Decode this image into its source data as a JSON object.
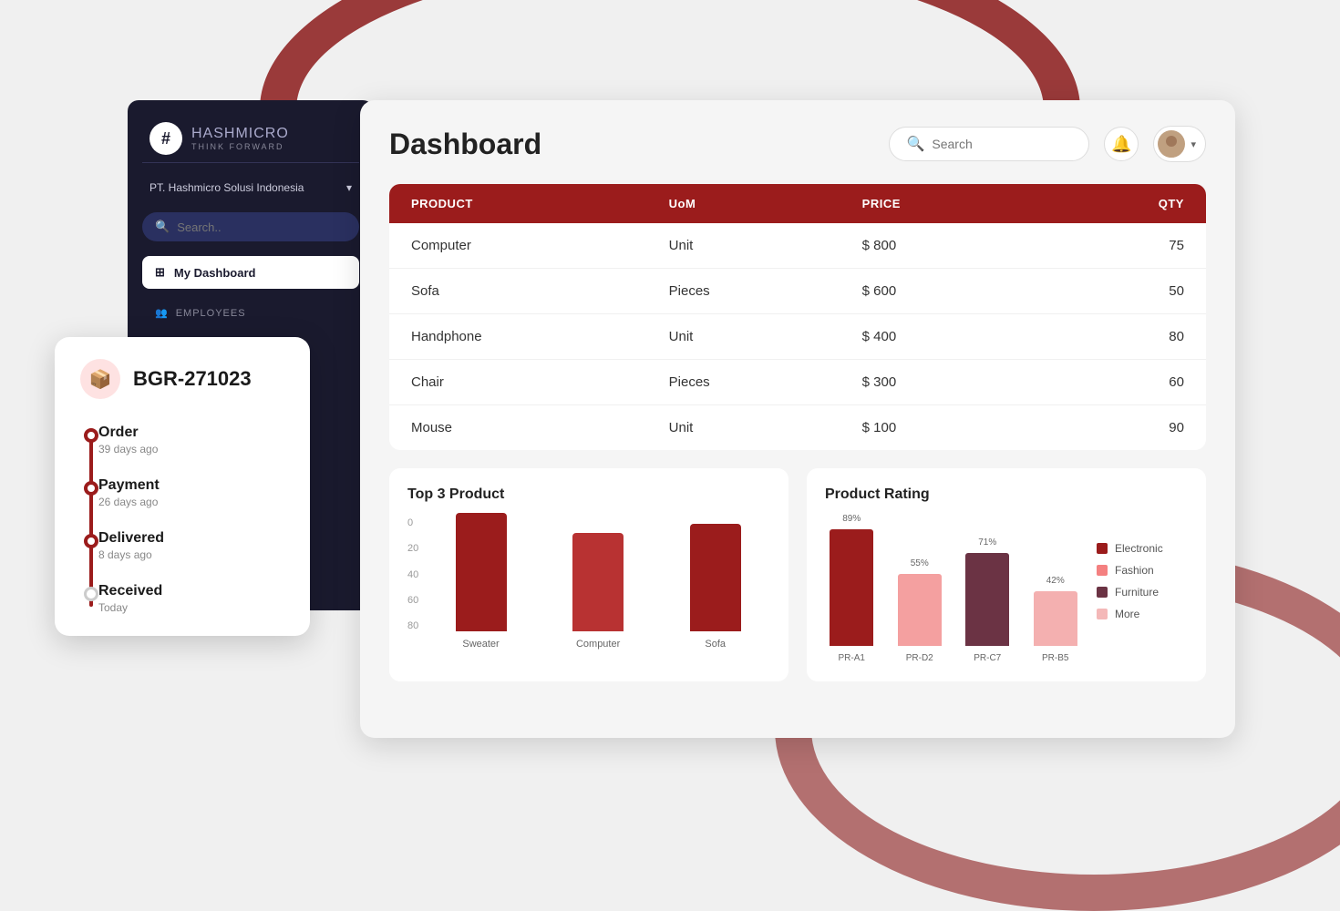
{
  "background": {
    "arc_color": "#8b1a1a"
  },
  "sidebar": {
    "logo": {
      "icon": "#",
      "name_bold": "HASH",
      "name_regular": "MICRO",
      "tagline": "THINK FORWARD"
    },
    "company": "PT. Hashmicro Solusi Indonesia",
    "search_placeholder": "Search..",
    "nav_items": [
      {
        "label": "My Dashboard",
        "active": true,
        "icon": "grid-icon"
      },
      {
        "label": "EMPLOYEES",
        "active": false,
        "icon": "users-icon"
      }
    ]
  },
  "header": {
    "title": "Dashboard",
    "search_placeholder": "Search",
    "notification_icon": "bell-icon",
    "avatar_icon": "avatar-icon"
  },
  "table": {
    "columns": [
      "PRODUCT",
      "UoM",
      "PRICE",
      "QTY"
    ],
    "rows": [
      {
        "product": "Computer",
        "uom": "Unit",
        "price": "$ 800",
        "qty": "75"
      },
      {
        "product": "Sofa",
        "uom": "Pieces",
        "price": "$ 600",
        "qty": "50"
      },
      {
        "product": "Handphone",
        "uom": "Unit",
        "price": "$ 400",
        "qty": "80"
      },
      {
        "product": "Chair",
        "uom": "Pieces",
        "price": "$ 300",
        "qty": "60"
      },
      {
        "product": "Mouse",
        "uom": "Unit",
        "price": "$ 100",
        "qty": "90"
      }
    ]
  },
  "top3_chart": {
    "title": "Top 3 Product",
    "y_labels": [
      "0",
      "20",
      "40",
      "60",
      "80"
    ],
    "bars": [
      {
        "label": "Sweater",
        "value": 72,
        "color": "#9b1c1c"
      },
      {
        "label": "Computer",
        "value": 60,
        "color": "#b83232"
      },
      {
        "label": "Sofa",
        "value": 65,
        "color": "#9b1c1c"
      }
    ],
    "max_value": 80
  },
  "rating_chart": {
    "title": "Product Rating",
    "bars": [
      {
        "label": "PR-A1",
        "value": 89,
        "value_label": "89%",
        "color": "#9b1c1c"
      },
      {
        "label": "PR-D2",
        "value": 55,
        "value_label": "55%",
        "color": "#f4a0a0"
      },
      {
        "label": "PR-C7",
        "value": 71,
        "value_label": "71%",
        "color": "#6b3344"
      },
      {
        "label": "PR-B5",
        "value": 42,
        "value_label": "42%",
        "color": "#f4b0b0"
      }
    ],
    "max_value": 100,
    "legend": [
      {
        "label": "Electronic",
        "color": "#9b1c1c"
      },
      {
        "label": "Fashion",
        "color": "#f48080"
      },
      {
        "label": "Furniture",
        "color": "#6b3344"
      },
      {
        "label": "More",
        "color": "#f4b8b8"
      }
    ]
  },
  "order_card": {
    "icon": "📦",
    "id": "BGR-271023",
    "timeline": [
      {
        "label": "Order",
        "time": "39 days ago",
        "status": "filled"
      },
      {
        "label": "Payment",
        "time": "26 days ago",
        "status": "filled"
      },
      {
        "label": "Delivered",
        "time": "8 days ago",
        "status": "filled"
      },
      {
        "label": "Received",
        "time": "Today",
        "status": "last"
      }
    ]
  }
}
